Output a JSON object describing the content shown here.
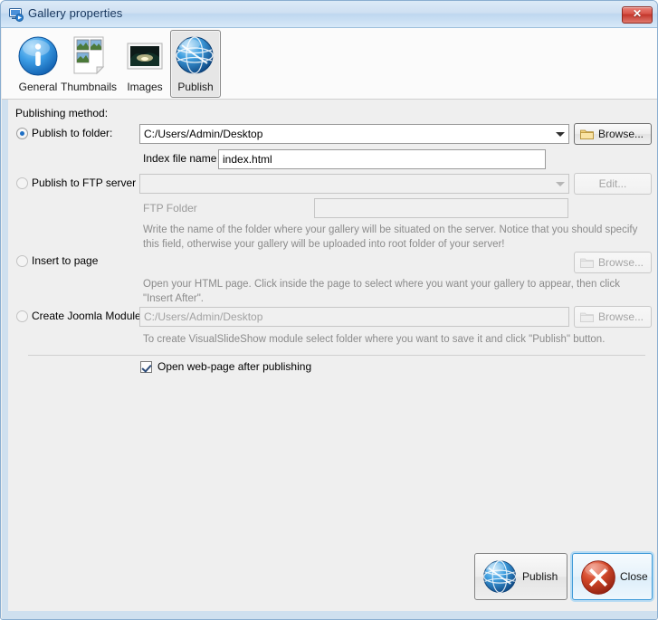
{
  "window": {
    "title": "Gallery properties",
    "title_icon": "gallery-properties-icon",
    "close_glyph": "✕"
  },
  "tabs": [
    {
      "label": "General",
      "icon": "info-icon",
      "selected": false
    },
    {
      "label": "Thumbnails",
      "icon": "thumbnails-icon",
      "selected": false
    },
    {
      "label": "Images",
      "icon": "images-icon",
      "selected": false
    },
    {
      "label": "Publish",
      "icon": "globe-icon",
      "selected": true
    }
  ],
  "main": {
    "section_title": "Publishing method:",
    "options": {
      "publish_to_folder": {
        "label": "Publish to folder:",
        "selected": true,
        "path_value": "C:/Users/Admin/Desktop",
        "browse_label": "Browse...",
        "index_label": "Index file name",
        "index_value": "index.html"
      },
      "publish_to_ftp": {
        "label": "Publish to FTP server",
        "selected": false,
        "server_value": "",
        "edit_label": "Edit...",
        "ftp_folder_label": "FTP Folder",
        "ftp_folder_value": "",
        "hint": "Write the name of the folder where your gallery will be situated on the server. Notice that you should specify this field, otherwise your gallery will be uploaded into root folder of your server!"
      },
      "insert_to_page": {
        "label": "Insert to page",
        "selected": false,
        "browse_label": "Browse...",
        "hint": "Open your HTML page. Click inside the page to select where you want your gallery to appear, then click \"Insert After\"."
      },
      "create_joomla_module": {
        "label": "Create Joomla Module",
        "selected": false,
        "path_value": "C:/Users/Admin/Desktop",
        "browse_label": "Browse...",
        "hint": "To create VisualSlideShow module select folder where you want to save it and click \"Publish\" button."
      }
    },
    "open_webpage": {
      "label": "Open web-page after publishing",
      "checked": true
    }
  },
  "footer": {
    "publish_label": "Publish",
    "publish_icon": "globe-icon",
    "close_label": "Close",
    "close_icon": "red-x-icon"
  },
  "colors": {
    "accent_blue": "#1e6fc4",
    "panel_bg": "#efefef",
    "title_bar": "#cfe0f2",
    "close_red": "#c3352b",
    "hint_gray": "#8b8b8b"
  }
}
